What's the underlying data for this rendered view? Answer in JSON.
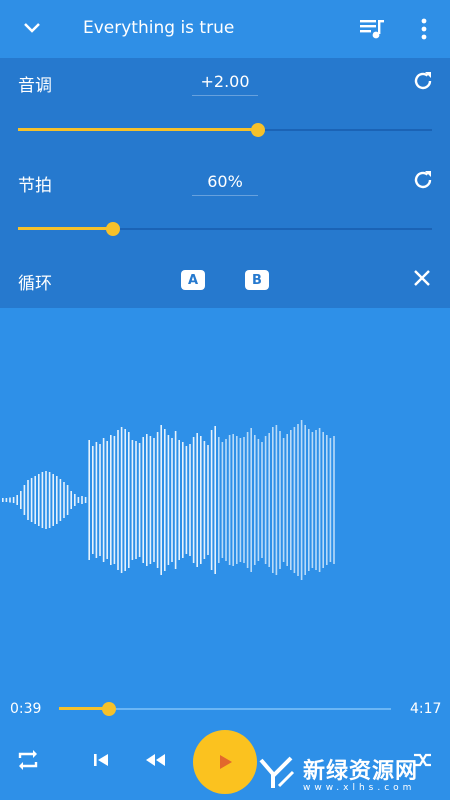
{
  "header": {
    "title": "Everything is true",
    "back_icon": "chevron-down-icon",
    "queue_icon": "playlist-music-icon",
    "more_icon": "more-vert-icon"
  },
  "pitch": {
    "label": "音调",
    "value": "+2.00",
    "level": 0.58
  },
  "tempo": {
    "label": "节拍",
    "value": "60%",
    "level": 0.23
  },
  "loop": {
    "label": "循环",
    "a_label": "A",
    "b_label": "B"
  },
  "player": {
    "current_time": "0:39",
    "total_time": "4:17",
    "progress": 0.15
  },
  "controls": {
    "repeat_icon": "repeat-icon",
    "previous_icon": "skip-previous-icon",
    "rewind_icon": "rewind-icon",
    "play_icon": "play-icon",
    "shuffle_icon": "shuffle-icon"
  },
  "watermark": {
    "cn": "新绿资源网",
    "en": "www.xlhs.com"
  },
  "colors": {
    "accent": "#F6C12A",
    "background": "#2E90E8",
    "panel": "#2679CE"
  }
}
